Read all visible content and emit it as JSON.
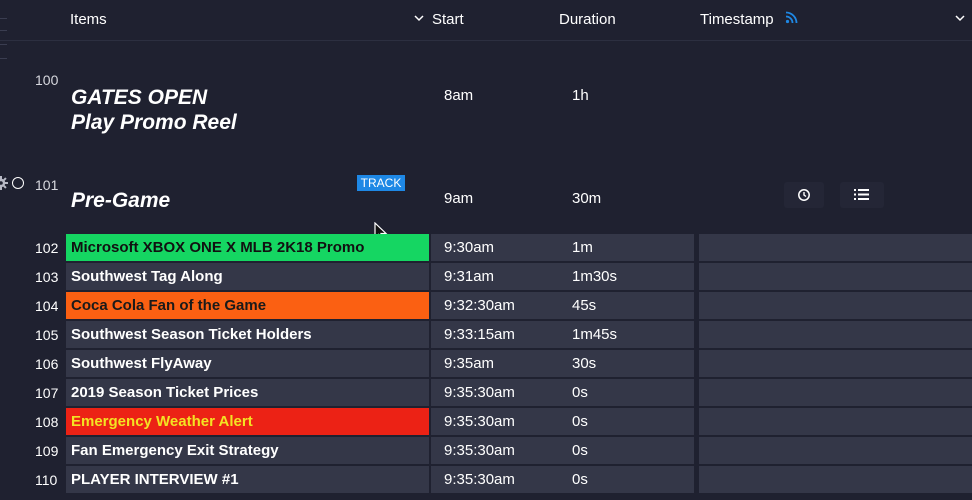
{
  "header": {
    "items": "Items",
    "start": "Start",
    "duration": "Duration",
    "timestamp": "Timestamp"
  },
  "big_rows": [
    {
      "num": "100",
      "title_line1": "GATES OPEN",
      "title_line2": "Play Promo Reel",
      "start": "8am",
      "duration": "1h"
    },
    {
      "num": "101",
      "title_line1": "Pre-Game",
      "badge": "TRACK",
      "start": "9am",
      "duration": "30m"
    }
  ],
  "rows": [
    {
      "num": "102",
      "item": "Microsoft XBOX ONE X MLB 2K18 Promo",
      "start": "9:30am",
      "duration": "1m",
      "bg": "#15d662",
      "fg": "#111111"
    },
    {
      "num": "103",
      "item": "Southwest Tag Along",
      "start": "9:31am",
      "duration": "1m30s",
      "bg": "",
      "fg": ""
    },
    {
      "num": "104",
      "item": "Coca Cola Fan of the Game",
      "start": "9:32:30am",
      "duration": "45s",
      "bg": "#fb6012",
      "fg": "#1a1a1a"
    },
    {
      "num": "105",
      "item": "Southwest Season Ticket Holders",
      "start": "9:33:15am",
      "duration": "1m45s",
      "bg": "",
      "fg": ""
    },
    {
      "num": "106",
      "item": "Southwest FlyAway",
      "start": "9:35am",
      "duration": "30s",
      "bg": "",
      "fg": ""
    },
    {
      "num": "107",
      "item": "2019 Season Ticket Prices",
      "start": "9:35:30am",
      "duration": "0s",
      "bg": "",
      "fg": ""
    },
    {
      "num": "108",
      "item": "Emergency Weather Alert",
      "start": "9:35:30am",
      "duration": "0s",
      "bg": "#ec2215",
      "fg": "#f3e323"
    },
    {
      "num": "109",
      "item": "Fan Emergency Exit Strategy",
      "start": "9:35:30am",
      "duration": "0s",
      "bg": "",
      "fg": ""
    },
    {
      "num": "110",
      "item": "PLAYER INTERVIEW #1",
      "start": "9:35:30am",
      "duration": "0s",
      "bg": "",
      "fg": ""
    }
  ],
  "icons": {
    "items_sort": "chevron-down-icon",
    "timestamp_feed": "rss-icon",
    "timestamp_menu": "chevron-down-icon",
    "settings": "gear-icon",
    "status": "circle-icon",
    "timer": "clock-icon",
    "list": "list-icon",
    "pointer": "mouse-cursor-icon"
  },
  "colors": {
    "background": "#1f2130",
    "row": "#343748",
    "accent": "#1e88e5"
  }
}
